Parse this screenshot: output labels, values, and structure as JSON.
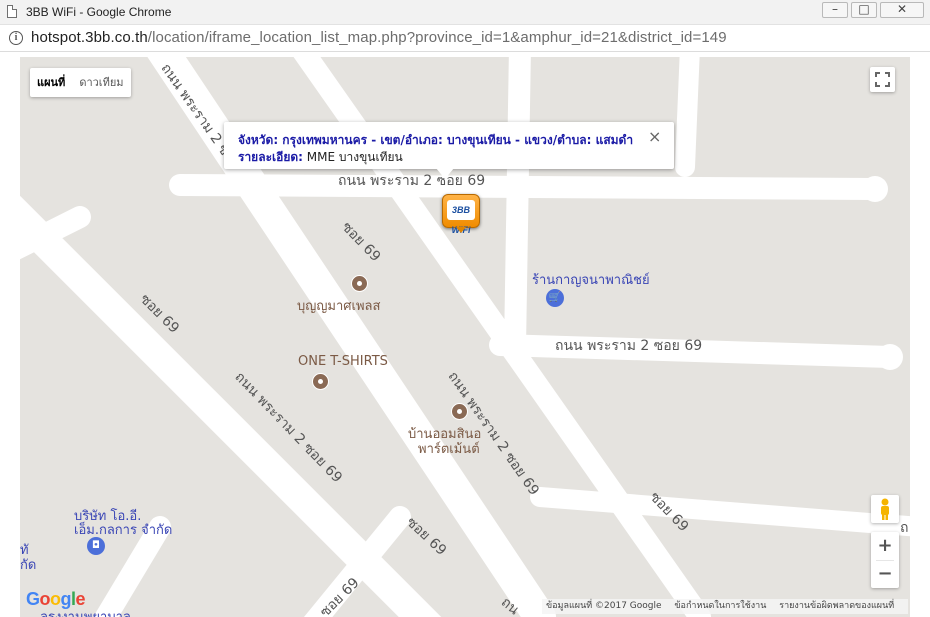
{
  "window": {
    "title": "3BB WiFi - Google Chrome",
    "minimize": "–",
    "maximize": "□",
    "close": "✕"
  },
  "address": {
    "host": "hotspot.3bb.co.th",
    "path": "/location/iframe_location_list_map.php?province_id=1&amphur_id=21&district_id=149"
  },
  "map": {
    "type_controls": {
      "map": "แผนที่",
      "satellite": "ดาวเทียม"
    },
    "infowindow": {
      "line1": "จังหวัด: กรุงเทพมหานคร - เขต/อำเภอ: บางขุนเทียน - แขวง/ตำบล: แสมดำ",
      "detail_label": "รายละเอียด:",
      "detail_value": "MME บางขุนเทียน",
      "close": "×"
    },
    "marker_text": "3BB WiFi",
    "road_labels": {
      "top_horizontal": "ถนน พระราม 2 ซอย 69",
      "mid_horizontal": "ถนน พระราม 2 ซอย 69",
      "diag_main": "ถนน พระราม 2 ซอย 69",
      "diag_top": "ถนน พระราม 2 ซ",
      "diag_left": "ถนน พระราม 2 ซอย 69",
      "soi_a": "ซอย 69",
      "soi_b": "ซอย 69",
      "soi_c": "ซอย 69",
      "soi_d": "ซอย 69",
      "soi_e": "ซอย 69",
      "bottom_partial": "ถน",
      "right_partial": "ถ"
    },
    "poi": {
      "p1": "บุญญมาศเพลส",
      "p2": "ONE T-SHIRTS",
      "p3_line1": "บ้านออมสินอ",
      "p3_line2": "พาร์ตเม้นต์",
      "shop1": "ร้านกาญจนาพาณิชย์",
      "company_line1": "บริษัท โอ.อี.",
      "company_line2": "เอ็ม.กลการ จำกัด",
      "left_partial1": "ทั",
      "left_partial2": "กัด",
      "bottom_partial": "ลรงงานพยาบาล"
    },
    "logo": [
      "G",
      "o",
      "o",
      "g",
      "l",
      "e"
    ],
    "logo_colors": [
      "#4285f4",
      "#ea4335",
      "#fbbc05",
      "#4285f4",
      "#34a853",
      "#ea4335"
    ],
    "attribution": {
      "data": "ข้อมูลแผนที่ ©2017 Google",
      "terms": "ข้อกำหนดในการใช้งาน",
      "report": "รายงานข้อผิดพลาดของแผนที่"
    },
    "zoom_in": "+",
    "zoom_out": "−"
  }
}
